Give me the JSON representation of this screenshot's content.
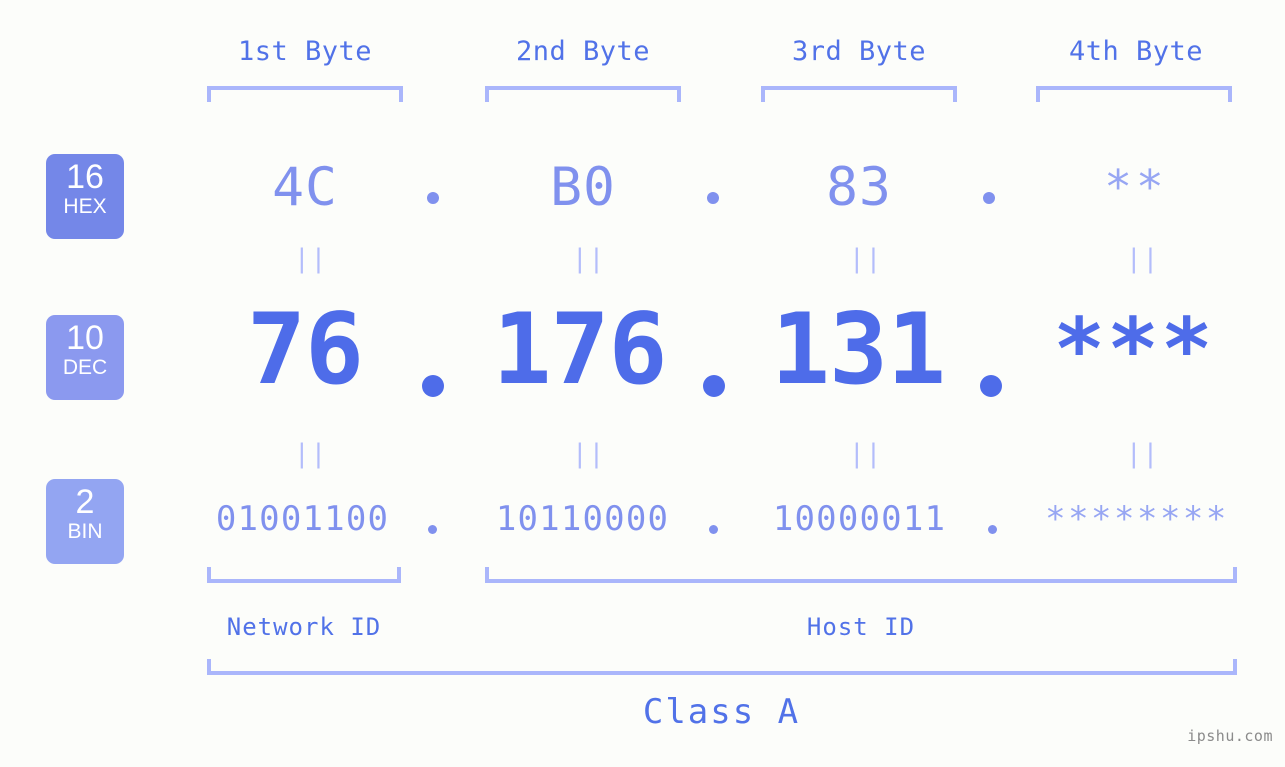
{
  "background_color": "#fcfdfa",
  "accent_color": "#5172e8",
  "light_accent_color": "#aab6fb",
  "mid_accent_color": "#8091ee",
  "byte_headers": [
    {
      "label": "1st Byte"
    },
    {
      "label": "2nd Byte"
    },
    {
      "label": "3rd Byte"
    },
    {
      "label": "4th Byte"
    }
  ],
  "bases": [
    {
      "number": "16",
      "name": "HEX",
      "badge_color": "#7487e8"
    },
    {
      "number": "10",
      "name": "DEC",
      "badge_color": "#8b99ef"
    },
    {
      "number": "2",
      "name": "BIN",
      "badge_color": "#93a5f2"
    }
  ],
  "rows": {
    "hex": {
      "values": [
        "4C",
        "B0",
        "83",
        "**"
      ],
      "separator": "."
    },
    "dec": {
      "values": [
        "76",
        "176",
        "131",
        "***"
      ],
      "separator": "."
    },
    "bin": {
      "values": [
        "01001100",
        "10110000",
        "10000011",
        "********"
      ],
      "separator": "."
    }
  },
  "equals_marks": {
    "symbol": "||",
    "hex_to_dec": [
      "||",
      "||",
      "||",
      "||"
    ],
    "dec_to_bin": [
      "||",
      "||",
      "||",
      "||"
    ]
  },
  "segments": {
    "network_id": "Network ID",
    "host_id": "Host ID"
  },
  "class_label": "Class A",
  "watermark": "ipshu.com"
}
